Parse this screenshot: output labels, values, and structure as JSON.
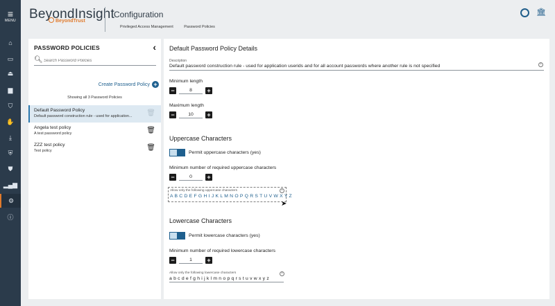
{
  "nav": {
    "menu_label": "MENU"
  },
  "header": {
    "brand": "BeyondInsight",
    "brand_sub": "BeyondTrust",
    "page_title": "Configuration",
    "breadcrumbs": [
      "Privileged Access Management",
      "Password Policies"
    ]
  },
  "left_panel": {
    "title": "PASSWORD POLICIES",
    "search_placeholder": "Search Password Policies",
    "create_label": "Create Password Policy",
    "showing_text": "Showing all 3 Password Policies",
    "policies": [
      {
        "name": "Default Password Policy",
        "description": "Default password construction rule - used for application..."
      },
      {
        "name": "Angela test policy",
        "description": "A test password policy"
      },
      {
        "name": "ZZZ test policy",
        "description": "Test policy"
      }
    ]
  },
  "details": {
    "title": "Default Password Policy Details",
    "description_label": "Description",
    "description_value": "Default password construction rule - used for application userids and for all account passwords where another rule is not specified",
    "min_length_label": "Minimum length",
    "min_length_value": "8",
    "max_length_label": "Maximum length",
    "max_length_value": "10",
    "uppercase": {
      "title": "Uppercase Characters",
      "toggle_label": "Permit uppercase characters (yes)",
      "min_label": "Minimum number of required uppercase characters",
      "min_value": "0",
      "allow_label": "Allow only the following uppercase characters",
      "allow_value": "A B C D E F G H I J K L M N O P Q R S T U V W X Y Z"
    },
    "lowercase": {
      "title": "Lowercase Characters",
      "toggle_label": "Permit lowercase characters (yes)",
      "min_label": "Minimum number of required lowercase characters",
      "min_value": "1",
      "allow_label": "Allow only the following lowercase characters",
      "allow_value": "a b c d e f g h i j k l m n o p q r s t u v w x y z"
    }
  },
  "colors": {
    "accent": "#1e5f8e",
    "rail": "#2b3b4b",
    "brand_orange": "#e07a2c"
  }
}
